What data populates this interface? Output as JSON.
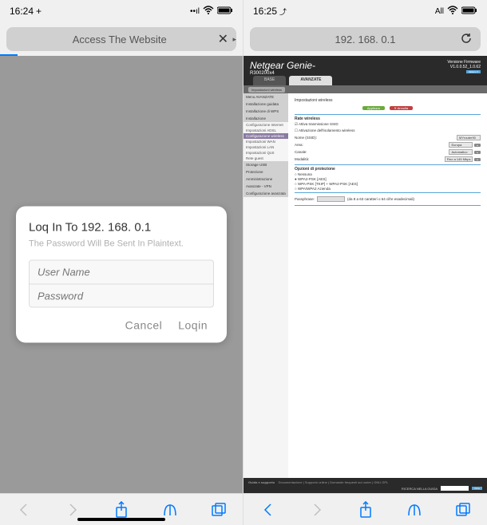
{
  "left": {
    "status": {
      "time": "16:24",
      "time_suffix": "+",
      "signal": "••ıl",
      "wifi": "wifi",
      "battery": "battery"
    },
    "url_bar": {
      "text": "Access The Website",
      "close_icon": "✕"
    },
    "dialog": {
      "title": "Loq In To 192. 168. 0.1",
      "subtitle": "The Password Will Be Sent In Plaintext.",
      "username_placeholder": "User Name",
      "password_placeholder": "Password",
      "cancel_label": "Cancel",
      "login_label": "Loqin"
    }
  },
  "right": {
    "status": {
      "time": "16:25",
      "time_suffix": "⤴",
      "label": "All",
      "wifi": "wifi",
      "battery": "battery"
    },
    "url_bar": {
      "text": "192. 168. 0.1",
      "reload_icon": "↻"
    },
    "netgear": {
      "brand": "Netgear Genie-",
      "model": "R300200x4",
      "version_label": "Versione Firmware",
      "version": "V1.0.0.52_1.0.62",
      "tabs": {
        "base": "BASE",
        "advanced": "AVANZATE"
      },
      "subbar_pill": "Impostazioni wireless",
      "subbar_extra": "",
      "sidebar": {
        "groups": [
          {
            "header": "Menu AVANZATE",
            "items": []
          },
          {
            "header": "Installazione guidata",
            "items": []
          },
          {
            "header": "Installazione di WPS",
            "items": []
          },
          {
            "header": "Installazione",
            "items": [
              "Configurazione Internet",
              "Impostazioni ADSL",
              "Configurazione wireless",
              "Impostazioni WAN",
              "Impostazioni LAN",
              "Impostazioni QoS",
              "Rete guest"
            ]
          },
          {
            "header": "Storage USB",
            "items": []
          },
          {
            "header": "Protezione",
            "items": []
          },
          {
            "header": "Amministrazione",
            "items": []
          },
          {
            "header": "Avanzate - VPN",
            "items": []
          },
          {
            "header": "Configurazione avanzata",
            "items": []
          }
        ],
        "active": "Configurazione wireless"
      },
      "main": {
        "topic": "Impostazioni wireless",
        "apply": "Applica ▸",
        "cancel": "✕ Annulla",
        "rate_wireless": "Rate wireless",
        "cb_ssid": "Attiva trasmissione SSID",
        "cb_isolation": "Attivazione dell'isolamento wireless",
        "name_label": "Nome (SSID):",
        "name_value": "MYrouter90",
        "area_label": "Area:",
        "area_value": "Europa",
        "channel_label": "Canale:",
        "channel_value": "Automatico",
        "mode_label": "Modalità:",
        "mode_value": "Fino a 145 Mbps",
        "protection": "Opzioni di protezione",
        "radios": [
          "Nessuna",
          "WPA2-PSK [AES]",
          "WPA-PSK [TKIP] + WPA2-PSK [AES]",
          "WPA/WPA2 Azienda"
        ],
        "radio_selected": "WPA2-PSK [AES]",
        "passphrase_label": "Passphrase:",
        "passphrase_hint": "(da 8 a 63 caratteri o 64 cifre esadecimali)"
      },
      "footer": {
        "guide": "Guida e supporto",
        "links": "Documentazione  |  Supporto online  |  Domande frequenti sul router  |  GNU GPL",
        "search_label": "RICERCA NELLA GUIDA",
        "btn": "VAI ▸"
      }
    }
  }
}
